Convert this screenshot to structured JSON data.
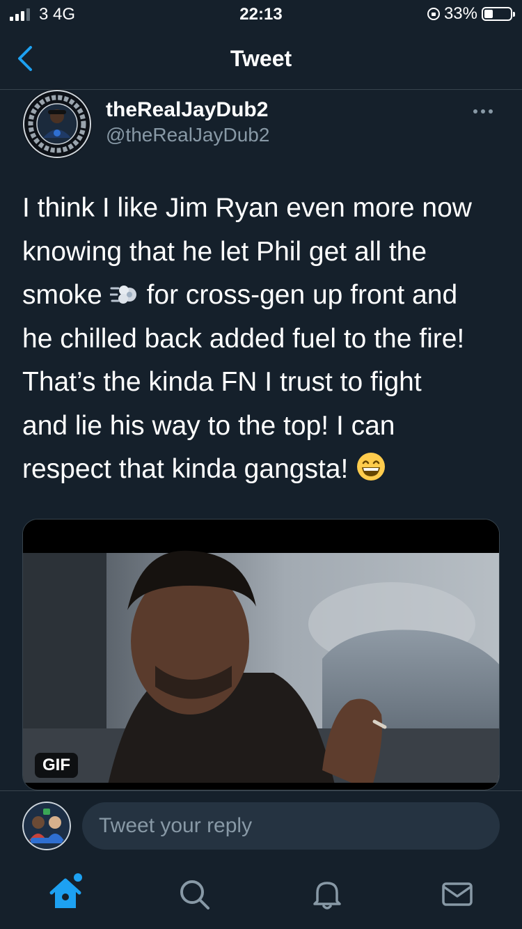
{
  "status_bar": {
    "carrier": "3  4G",
    "time": "22:13",
    "battery": "33%"
  },
  "header": {
    "title": "Tweet"
  },
  "tweet": {
    "display_name": "theRealJayDub2",
    "handle": "@theRealJayDub2",
    "text_part1": "I think I like Jim Ryan even more now\nknowing that he let Phil get all the\nsmoke",
    "text_part2": "for cross-gen up front and\nhe chilled back added fuel to the fire!\nThat’s the kinda FN I trust to fight\nand lie his way to the top! I can\nrespect that kinda gangsta!",
    "media_badge": "GIF"
  },
  "reply": {
    "placeholder": "Tweet your reply"
  },
  "tabs": [
    {
      "icon": "home-icon"
    },
    {
      "icon": "search-icon"
    },
    {
      "icon": "notifications-icon"
    },
    {
      "icon": "messages-icon"
    }
  ],
  "colors": {
    "background": "#15202b",
    "accent": "#1da1f2",
    "secondary_text": "#8899a6",
    "divider": "#38444d"
  }
}
